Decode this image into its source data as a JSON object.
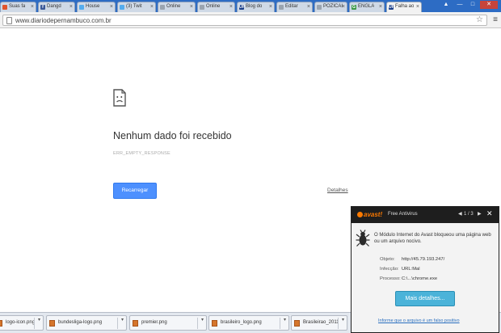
{
  "browser": {
    "tabs": [
      {
        "label": "Suas fa",
        "icon_color": "#e2542c",
        "icon_glyph": "",
        "active": false
      },
      {
        "label": "Dangd",
        "icon_color": "#3b5998",
        "icon_glyph": "f",
        "active": false
      },
      {
        "label": "House",
        "icon_color": "#55acee",
        "icon_glyph": "",
        "active": false
      },
      {
        "label": "(3) Twit",
        "icon_color": "#55acee",
        "icon_glyph": "",
        "active": false
      },
      {
        "label": "Online",
        "icon_color": "#9aa4b0",
        "icon_glyph": "",
        "active": false
      },
      {
        "label": "Online",
        "icon_color": "#9aa4b0",
        "icon_glyph": "",
        "active": false
      },
      {
        "label": "Blog do",
        "icon_color": "#1b3f8a",
        "icon_glyph": "UP",
        "active": false
      },
      {
        "label": "Editar",
        "icon_color": "#9aa4b0",
        "icon_glyph": "",
        "active": false
      },
      {
        "label": "POZICAI",
        "icon_color": "#9aa4b0",
        "icon_glyph": "",
        "active": false
      },
      {
        "label": "ENGLA",
        "icon_color": "#3d9a48",
        "icon_glyph": "G",
        "active": false
      },
      {
        "label": "Falha ao",
        "icon_color": "#1b3f8a",
        "icon_glyph": "UP",
        "active": true
      }
    ],
    "tab_close_glyph": "×",
    "window_buttons": {
      "user": "▲",
      "minimize": "—",
      "maximize": "□",
      "close": "✕"
    },
    "url": "www.diariodepernambuco.com.br",
    "star_icon": "☆",
    "menu_icon": "≡"
  },
  "error_page": {
    "title": "Nenhum dado foi recebido",
    "code": "ERR_EMPTY_RESPONSE",
    "reload_label": "Recarregar",
    "details_label": "Detalhes"
  },
  "downloads": [
    {
      "name": "logo-icon.png"
    },
    {
      "name": "bundesliga-logo.png"
    },
    {
      "name": "premier.png"
    },
    {
      "name": "brasileiro_logo.png"
    },
    {
      "name": "Brasileirao_2011_Lo...png"
    }
  ],
  "downloads_arrow": "▾",
  "avast": {
    "brand": "avast!",
    "product": "Free Antivirus",
    "nav_prev": "◀",
    "pager": "1 / 3",
    "nav_next": "▶",
    "close": "✕",
    "message": "O Módulo Internet do Avast bloqueou uma página web ou um arquivo nocivo.",
    "rows": [
      {
        "key": "Objeto:",
        "value": "http://45.79.193.247/"
      },
      {
        "key": "Infecção:",
        "value": "URL:Mal"
      },
      {
        "key": "Processo:",
        "value": "C:\\...\\chrome.exe"
      }
    ],
    "more_details_label": "Mais detalhes...",
    "false_positive_label": "Informe que o arquivo é um falso positivo",
    "accent_color": "#ff7a00"
  }
}
